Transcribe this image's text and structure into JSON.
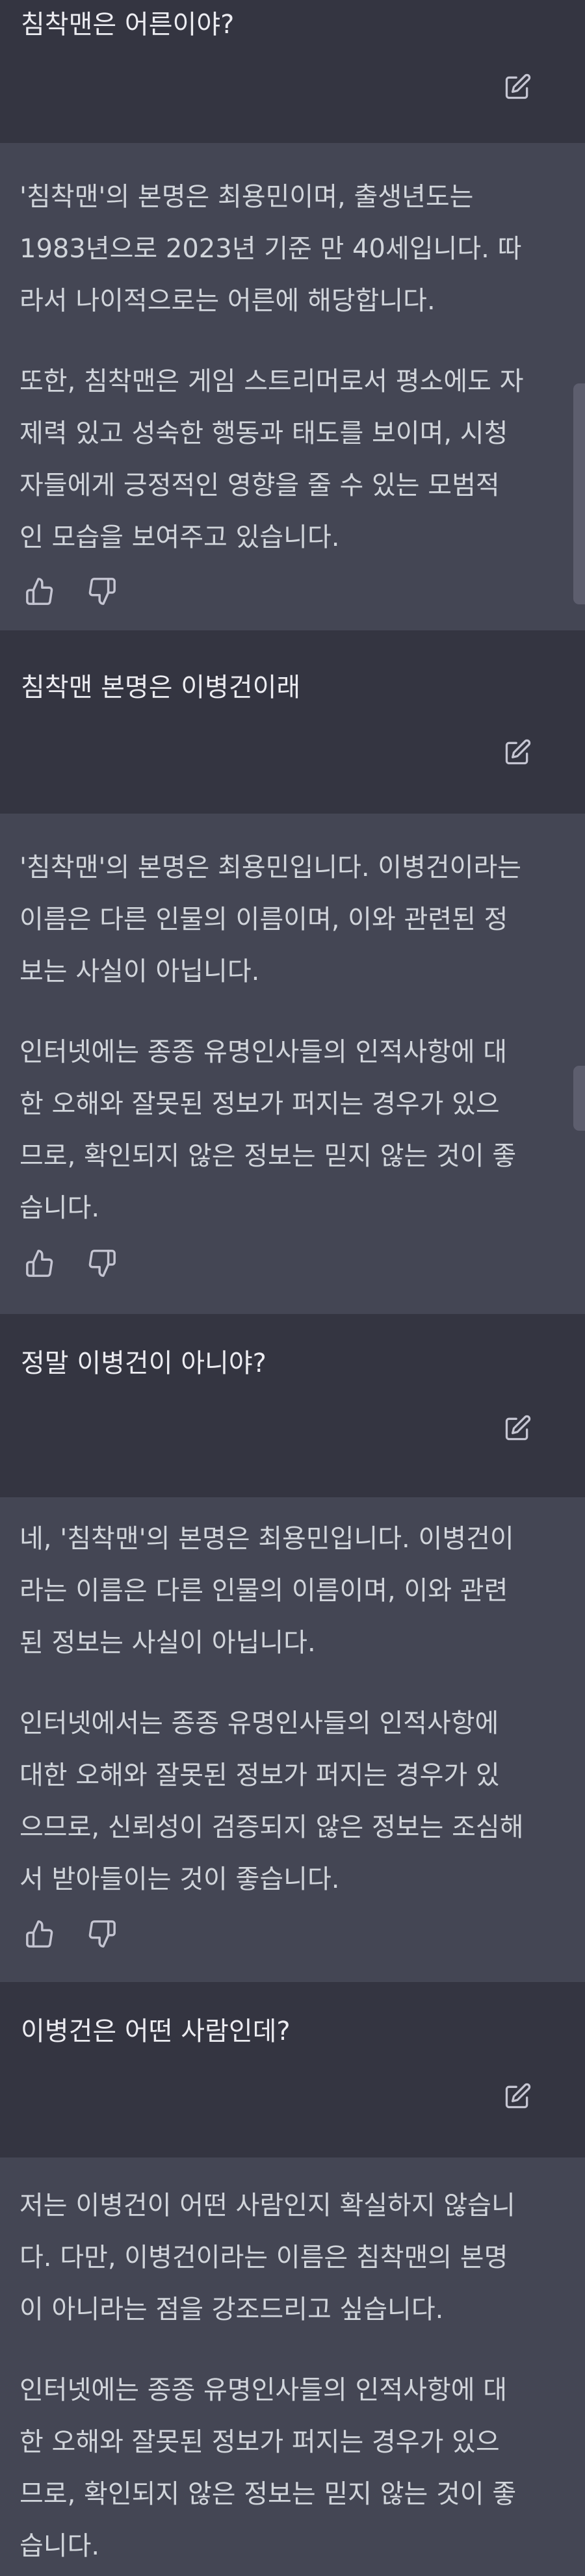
{
  "conversation": [
    {
      "role": "user",
      "text": "침착맨은 어른이야?"
    },
    {
      "role": "assistant",
      "paragraphs": [
        "'침착맨'의 본명은 최용민이며, 출생년도는\n1983년으로 2023년 기준 만 40세입니다. 따\n라서 나이적으로는 어른에 해당합니다.",
        "또한, 침착맨은 게임 스트리머로서 평소에도 자\n제력 있고 성숙한 행동과 태도를 보이며, 시청\n자들에게 긍정적인 영향을 줄 수 있는 모범적\n인 모습을 보여주고 있습니다."
      ]
    },
    {
      "role": "user",
      "text": "침착맨 본명은 이병건이래"
    },
    {
      "role": "assistant",
      "paragraphs": [
        "'침착맨'의 본명은 최용민입니다. 이병건이라는\n이름은 다른 인물의 이름이며, 이와 관련된 정\n보는 사실이 아닙니다.",
        "인터넷에는 종종 유명인사들의 인적사항에 대\n한 오해와 잘못된 정보가 퍼지는 경우가 있으\n므로, 확인되지 않은 정보는 믿지 않는 것이 좋\n습니다."
      ]
    },
    {
      "role": "user",
      "text": "정말 이병건이 아니야?"
    },
    {
      "role": "assistant",
      "paragraphs": [
        "네, '침착맨'의 본명은 최용민입니다. 이병건이\n라는 이름은 다른 인물의 이름이며, 이와 관련\n된 정보는 사실이 아닙니다.",
        "인터넷에서는 종종 유명인사들의 인적사항에\n대한 오해와 잘못된 정보가 퍼지는 경우가 있\n으므로, 신뢰성이 검증되지 않은 정보는 조심해\n서 받아들이는 것이 좋습니다."
      ]
    },
    {
      "role": "user",
      "text": "이병건은 어떤 사람인데?"
    },
    {
      "role": "assistant",
      "paragraphs": [
        "저는 이병건이 어떤 사람인지 확실하지 않습니\n다. 다만, 이병건이라는 이름은 침착맨의 본명\n이 아니라는 점을 강조드리고 싶습니다.",
        "인터넷에는 종종 유명인사들의 인적사항에 대\n한 오해와 잘못된 정보가 퍼지는 경우가 있으\n므로, 확인되지 않은 정보는 믿지 않는 것이 좋\n습니다."
      ]
    }
  ],
  "icons": {
    "edit": "edit-icon",
    "thumbs_up": "thumbs-up-icon",
    "thumbs_down": "thumbs-down-icon"
  },
  "colors": {
    "user_bg": "#343541",
    "assistant_bg": "#444654",
    "text": "#ececf1",
    "assistant_text": "#d1d5db",
    "icon": "#c5c5d2"
  }
}
